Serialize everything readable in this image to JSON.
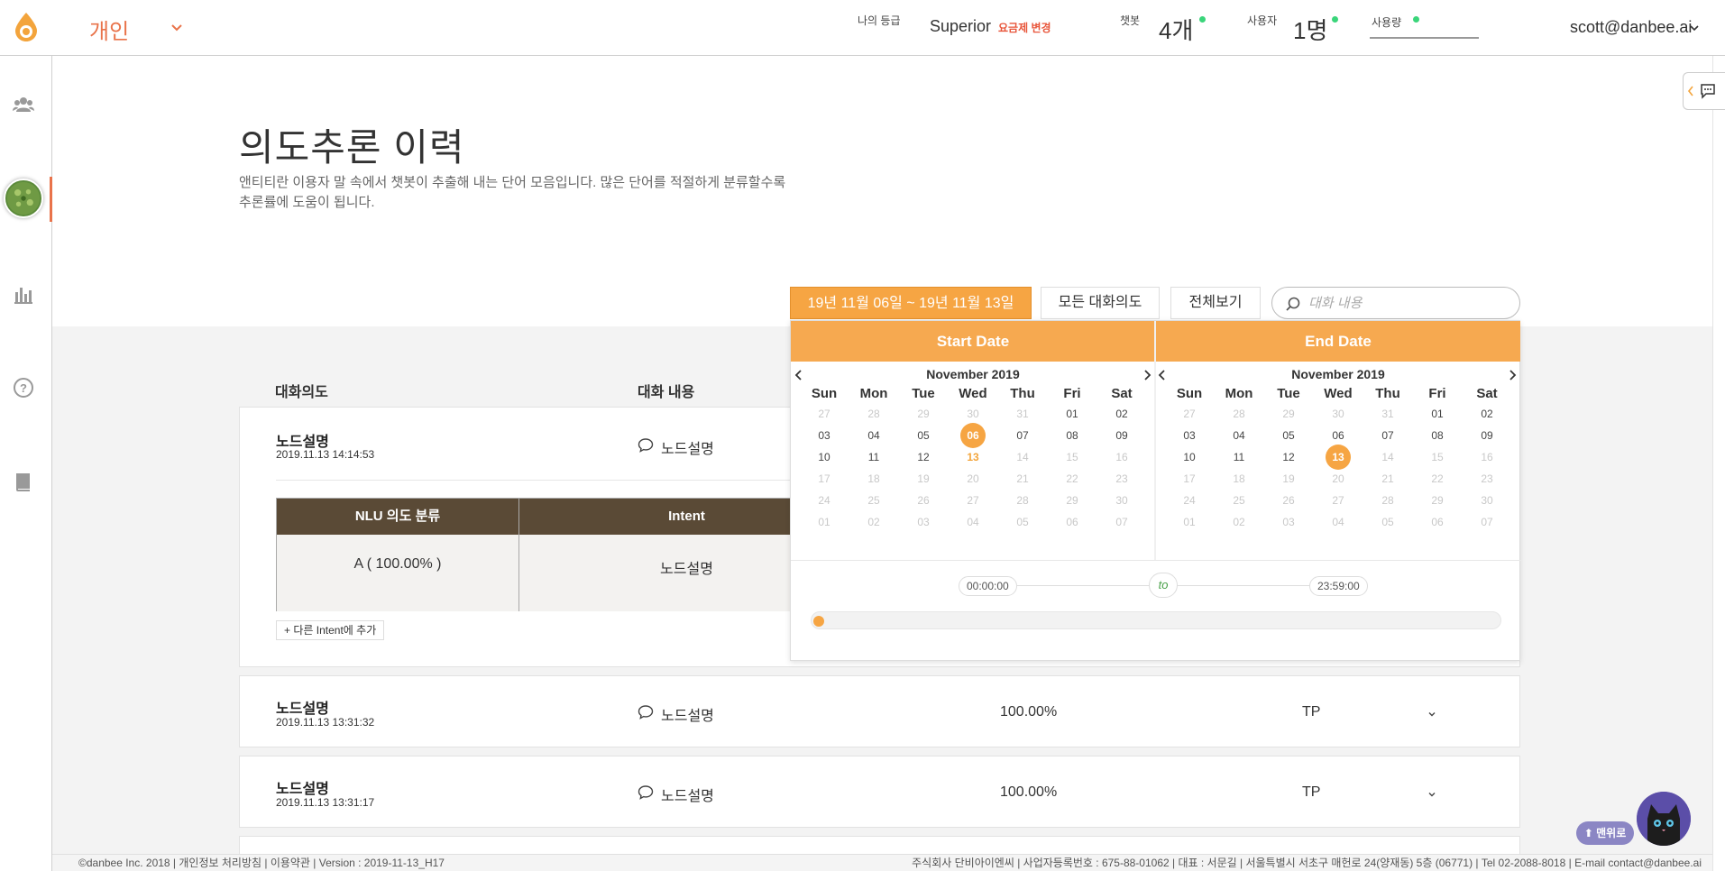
{
  "header": {
    "workspace": "개인",
    "grade_label": "나의 등급",
    "grade_value": "Superior",
    "plan_change": "요금제 변경",
    "chatbot_label": "챗봇",
    "chatbot_value": "4개",
    "users_label": "사용자",
    "users_value": "1명",
    "usage_label": "사용량",
    "user_email": "scott@danbee.ai",
    "status_color": "#3ad57a",
    "accent_color": "#e9734a"
  },
  "page": {
    "title": "의도추론 이력",
    "description": "앤티티란 이용자 말 속에서 챗봇이 추출해 내는 단어 모음입니다. 많은 단어를 적절하게 분류할수록 추론률에 도움이 됩니다."
  },
  "filters": {
    "date_range": "19년 11월 06일 ~ 19년 11월 13일",
    "intent_filter": "모든 대화의도",
    "view_all": "전체보기",
    "search_placeholder": "대화 내용"
  },
  "table": {
    "col_intent": "대화의도",
    "col_content": "대화 내용",
    "rows": [
      {
        "title": "노드설명",
        "date": "2019.11.13 14:14:53",
        "content": "노드설명",
        "score": "",
        "tp": ""
      },
      {
        "title": "노드설명",
        "date": "2019.11.13 13:31:32",
        "content": "노드설명",
        "score": "100.00%",
        "tp": "TP"
      },
      {
        "title": "노드설명",
        "date": "2019.11.13 13:31:17",
        "content": "노드설명",
        "score": "100.00%",
        "tp": "TP"
      }
    ],
    "detail": {
      "head_nlu": "NLU 의도 분류",
      "head_intent": "Intent",
      "nlu_value": "A ( 100.00% )",
      "intent_value": "노드설명",
      "add_intent": "+ 다른 Intent에 추가"
    }
  },
  "picker": {
    "start_label": "Start Date",
    "end_label": "End Date",
    "left_month": "November 2019",
    "right_month": "November 2019",
    "weekdays": [
      "Sun",
      "Mon",
      "Tue",
      "Wed",
      "Thu",
      "Fri",
      "Sat"
    ],
    "weeks": [
      [
        "27",
        "28",
        "29",
        "30",
        "31",
        "01",
        "02"
      ],
      [
        "03",
        "04",
        "05",
        "06",
        "07",
        "08",
        "09"
      ],
      [
        "10",
        "11",
        "12",
        "13",
        "14",
        "15",
        "16"
      ],
      [
        "17",
        "18",
        "19",
        "20",
        "21",
        "22",
        "23"
      ],
      [
        "24",
        "25",
        "26",
        "27",
        "28",
        "29",
        "30"
      ],
      [
        "01",
        "02",
        "03",
        "04",
        "05",
        "06",
        "07"
      ]
    ],
    "start_time": "00:00:00",
    "to_label": "to",
    "end_time": "23:59:00",
    "selected_start": "06",
    "selected_end": "13",
    "accent": "#f6a543"
  },
  "footer": {
    "left": "©danbee Inc. 2018 | 개인정보 처리방침 | 이용약관 | Version : 2019-11-13_H17",
    "right": "주식회사 단비아이엔씨 | 사업자등록번호 : 675-88-01062 | 대표 : 서문길 | 서울특별시 서초구 매헌로 24(양재동) 5층 (06771) | Tel 02-2088-8018 | E-mail contact@danbee.ai"
  },
  "floating": {
    "top_button": "⬆ 맨위로"
  }
}
